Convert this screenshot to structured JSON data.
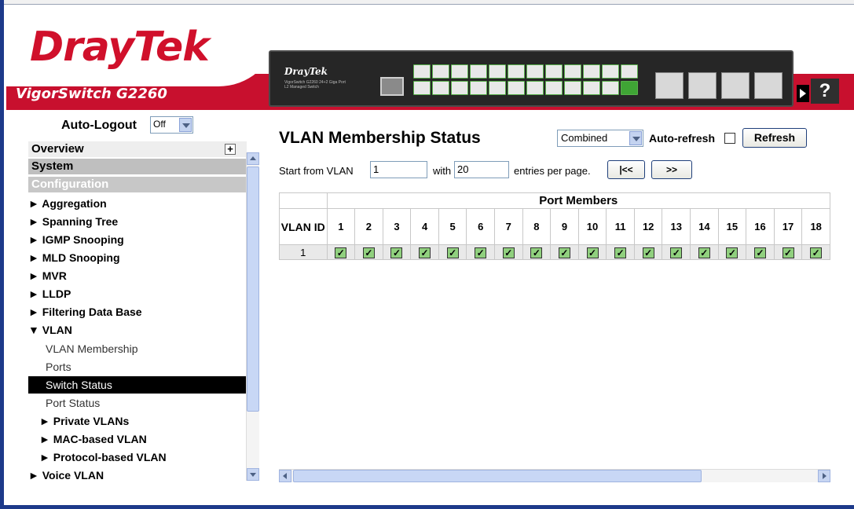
{
  "header": {
    "logo_text": "DrayTek",
    "model": "VigorSwitch G2260",
    "device_brand": "DrayTek",
    "device_subtitle": "VigorSwitch G2260 24+2 Giga Port L2 Managed Switch",
    "help_label": "?"
  },
  "sidebar": {
    "autologout_label": "Auto-Logout",
    "autologout_value": "Off",
    "overview": "Overview",
    "system": "System",
    "configuration": "Configuration",
    "items": [
      {
        "label": "► Aggregation"
      },
      {
        "label": "► Spanning Tree"
      },
      {
        "label": "► IGMP Snooping"
      },
      {
        "label": "► MLD Snooping"
      },
      {
        "label": "► MVR"
      },
      {
        "label": "► LLDP"
      },
      {
        "label": "► Filtering Data Base"
      },
      {
        "label": "▼ VLAN"
      }
    ],
    "vlan_sub": [
      {
        "label": "VLAN Membership"
      },
      {
        "label": "Ports"
      },
      {
        "label": "Switch Status"
      },
      {
        "label": "Port Status"
      }
    ],
    "vlan_sub_bold": [
      {
        "label": "► Private VLANs"
      },
      {
        "label": "► MAC-based VLAN"
      },
      {
        "label": "► Protocol-based VLAN"
      }
    ],
    "last_item": "► Voice VLAN"
  },
  "main": {
    "title": "VLAN Membership Status",
    "mode_value": "Combined",
    "auto_refresh_label": "Auto-refresh",
    "refresh_label": "Refresh",
    "start_label": "Start from VLAN",
    "start_value": "1",
    "with_label": "with",
    "with_value": "20",
    "entries_label": "entries per page.",
    "prev_label": "|<<",
    "next_label": ">>"
  },
  "table": {
    "group_header": "Port Members",
    "vlan_id_header": "VLAN ID",
    "ports": [
      "1",
      "2",
      "3",
      "4",
      "5",
      "6",
      "7",
      "8",
      "9",
      "10",
      "11",
      "12",
      "13",
      "14",
      "15",
      "16",
      "17",
      "18"
    ],
    "rows": [
      {
        "vlan": "1",
        "members": [
          true,
          true,
          true,
          true,
          true,
          true,
          true,
          true,
          true,
          true,
          true,
          true,
          true,
          true,
          true,
          true,
          true,
          true
        ]
      }
    ]
  },
  "colors": {
    "brand_red": "#c8102e",
    "frame_blue": "#1d3a8a",
    "active_menu": "#000000",
    "checkbox_green": "#90d07e"
  }
}
